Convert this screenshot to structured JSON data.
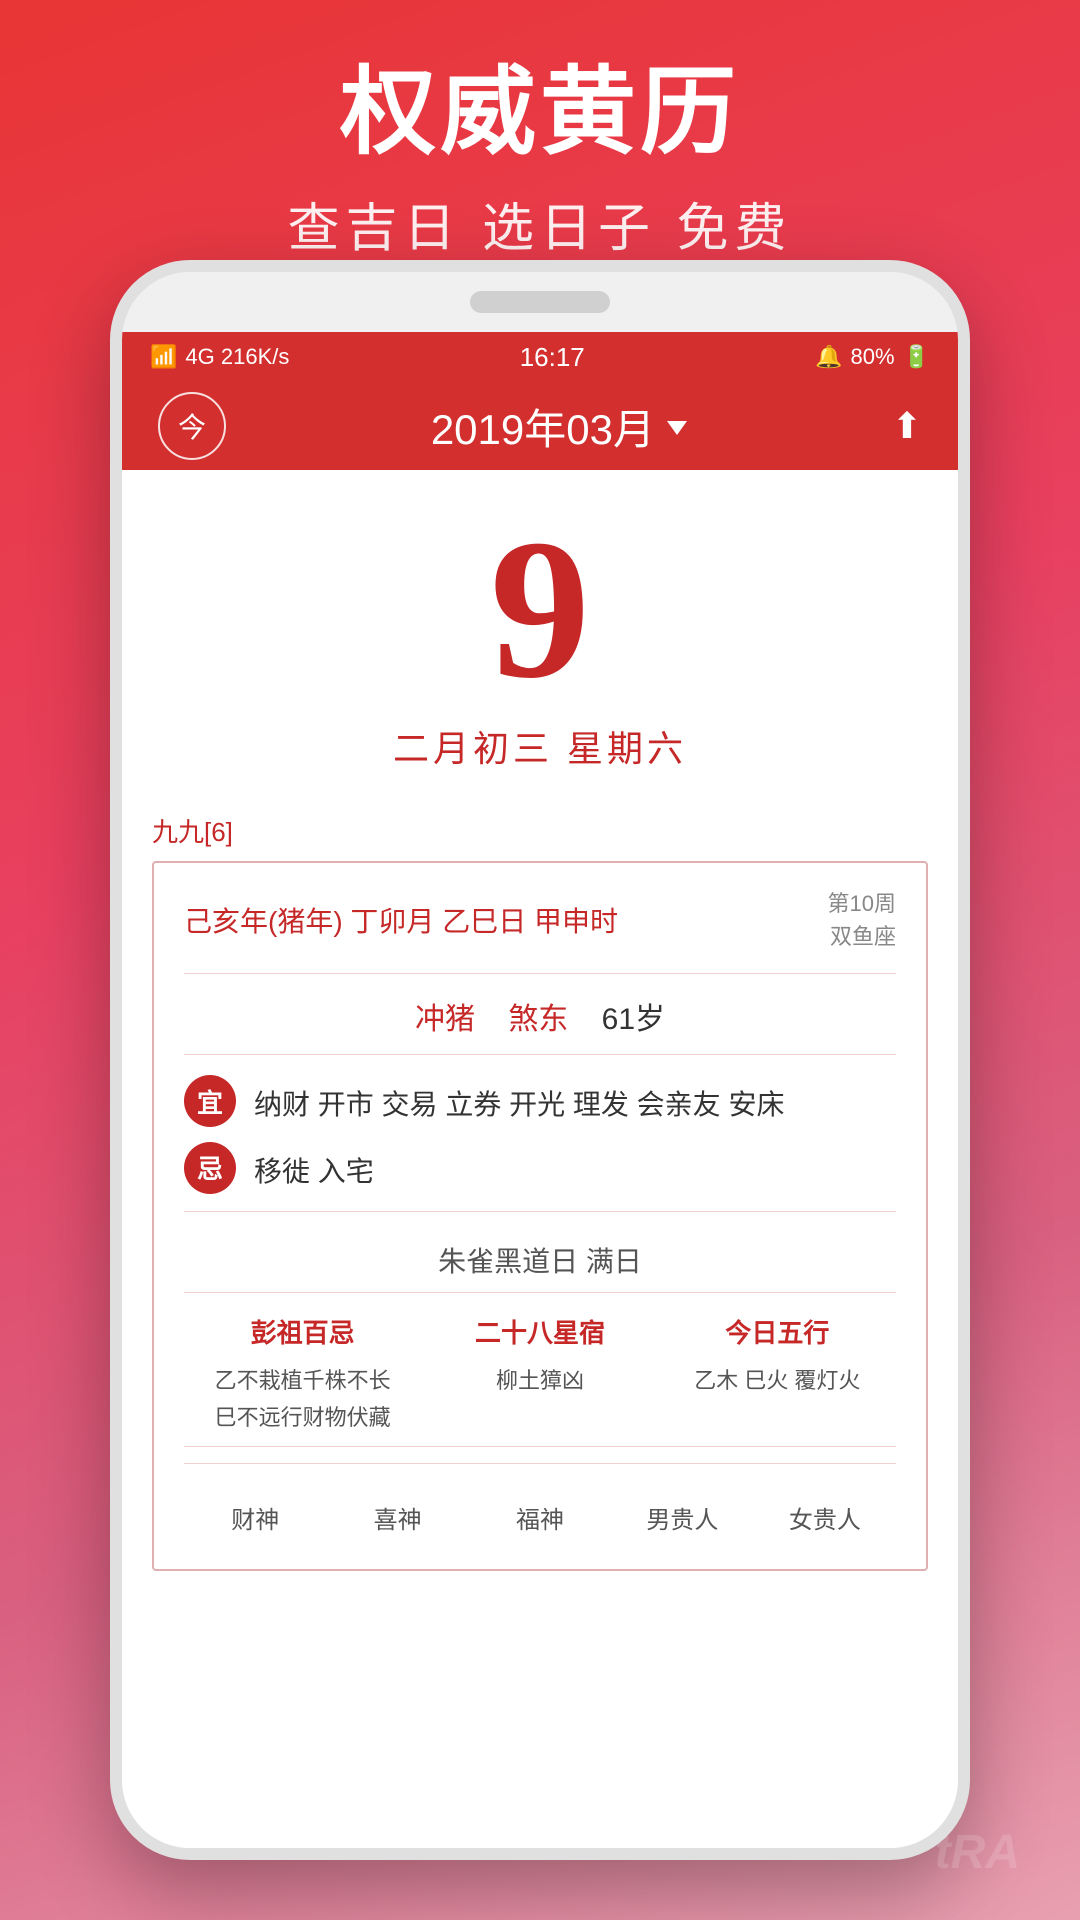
{
  "promo": {
    "title": "权威黄历",
    "subtitle": "查吉日 选日子 免费"
  },
  "status_bar": {
    "signal": "4G  216K/s",
    "wifi": "WiFi",
    "time": "16:17",
    "alarm": "🔔",
    "battery": "80%"
  },
  "header": {
    "today_label": "今",
    "month_selector": "2019年03月",
    "share_icon": "share"
  },
  "date": {
    "day": "9",
    "lunar": "二月初三  星期六"
  },
  "jiu_label": "九九[6]",
  "ganzhi": {
    "text": "己亥年(猪年) 丁卯月  乙巳日  甲申时",
    "week": "第10周",
    "zodiac": "双鱼座"
  },
  "chong": {
    "label": "冲猪",
    "direction": "煞东",
    "age": "61岁"
  },
  "yi": {
    "badge": "宜",
    "text": "纳财 开市 交易 立券 开光 理发 会亲友\n安床"
  },
  "ji": {
    "badge": "忌",
    "text": "移徙 入宅"
  },
  "zhique": "朱雀黑道日  满日",
  "three_cols": [
    {
      "title": "彭祖百忌",
      "lines": [
        "乙不栽植千株不长",
        "巳不远行财物伏藏"
      ]
    },
    {
      "title": "二十八星宿",
      "lines": [
        "柳土獐凶"
      ]
    },
    {
      "title": "今日五行",
      "lines": [
        "乙木 巳火 覆灯火"
      ]
    }
  ],
  "five_cols": [
    "财神",
    "喜神",
    "福神",
    "男贵人",
    "女贵人"
  ],
  "watermark": "tRA"
}
